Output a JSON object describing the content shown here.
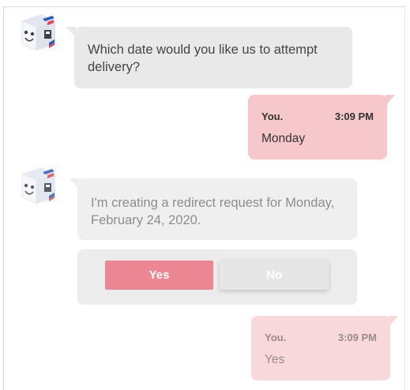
{
  "conversation": {
    "messages": [
      {
        "sender": "bot",
        "text": "Which date would you like us to attempt delivery?"
      },
      {
        "sender": "user",
        "name": "You.",
        "time": "3:09 PM",
        "text": "Monday"
      },
      {
        "sender": "bot",
        "text": "I'm creating a redirect request for Monday, February 24, 2020."
      },
      {
        "sender": "user",
        "name": "You.",
        "time": "3:09 PM",
        "text": "Yes"
      }
    ],
    "choices": {
      "yes_label": "Yes",
      "no_label": "No"
    }
  },
  "colors": {
    "bot_bubble": "#e9e9e9",
    "user_bubble": "#f6c7cb",
    "yes_button": "#ec8692",
    "no_button": "#e6e6e6"
  },
  "icons": {
    "avatar": "bot-box-avatar-icon"
  }
}
